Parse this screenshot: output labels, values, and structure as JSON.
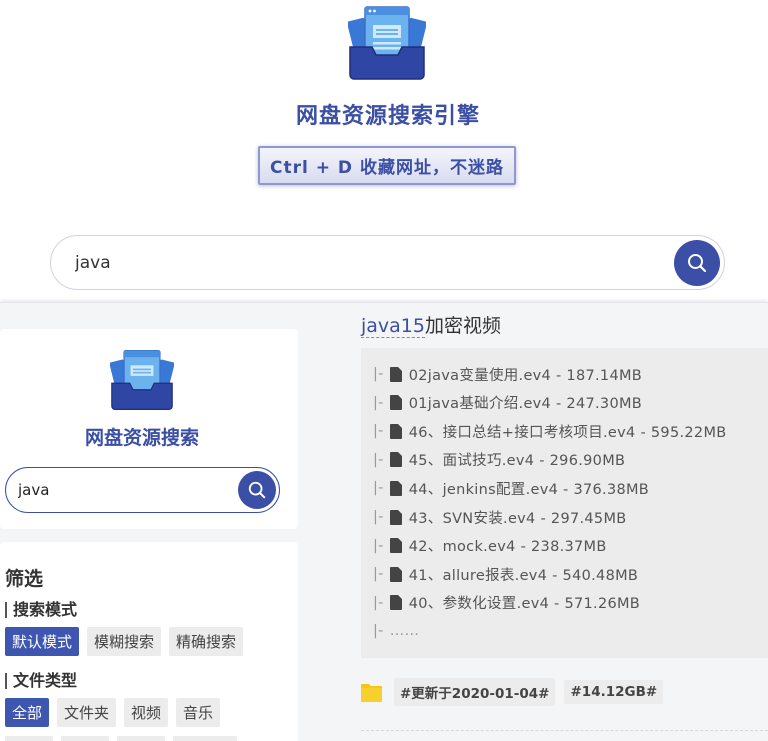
{
  "hero": {
    "title": "网盘资源搜索引擎",
    "badge": "Ctrl + D 收藏网址，不迷路",
    "search_value": "java"
  },
  "sidebar": {
    "title": "网盘资源搜索",
    "search_value": "java"
  },
  "filters": {
    "title": "筛选",
    "mode_label": "搜索模式",
    "modes": [
      "默认模式",
      "模糊搜索",
      "精确搜索"
    ],
    "type_label": "文件类型",
    "types": [
      "全部",
      "文件夹",
      "视频",
      "音乐"
    ]
  },
  "result": {
    "title_keyword": "java15",
    "title_rest": "加密视频",
    "files": [
      "02java变量使用.ev4 - 187.14MB",
      "01java基础介绍.ev4 - 247.30MB",
      "46、接口总结+接口考核项目.ev4 - 595.22MB",
      "45、面试技巧.ev4 - 296.90MB",
      "44、jenkins配置.ev4 - 376.38MB",
      "43、SVN安装.ev4 - 297.45MB",
      "42、mock.ev4 - 238.37MB",
      "41、allure报表.ev4 - 540.48MB",
      "40、参数化设置.ev4 - 571.26MB"
    ],
    "tree_prefix": "|-",
    "more": "……",
    "updated_tag": "#更新于2020-01-04#",
    "size_tag": "#14.12GB#"
  },
  "icons": {
    "logo": "inbox-tray-icon",
    "search": "search-icon",
    "file": "file-icon",
    "folder": "folder-icon"
  },
  "colors": {
    "brand": "#3a4fa5",
    "folder": "#f5c518"
  }
}
